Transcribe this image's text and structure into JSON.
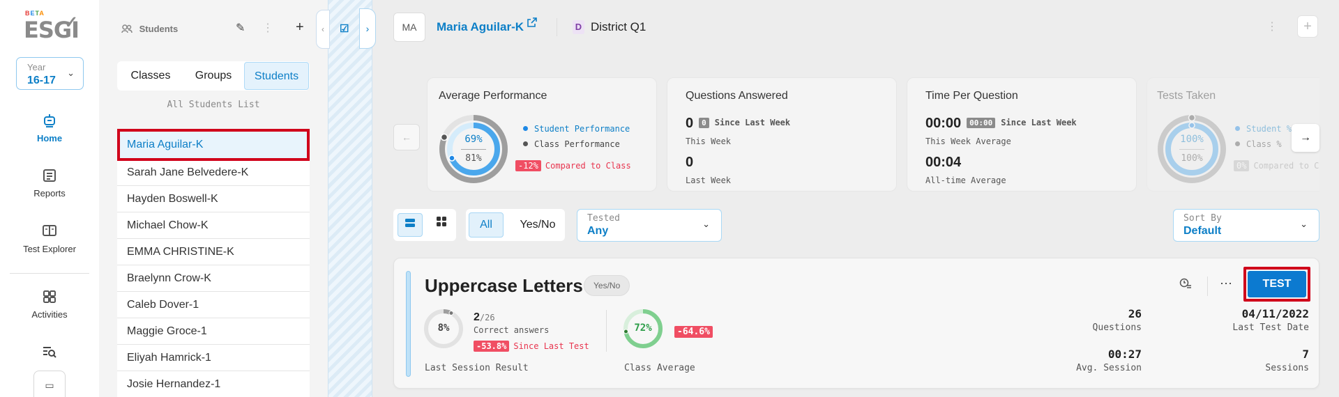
{
  "nav": {
    "logo_beta": "BETA",
    "logo_text": "ESGI",
    "year_label": "Year",
    "year_value": "16-17",
    "items": [
      {
        "label": "Home"
      },
      {
        "label": "Reports"
      },
      {
        "label": "Test Explorer"
      },
      {
        "label": "Activities"
      }
    ]
  },
  "panel": {
    "header": "Students",
    "tabs": [
      "Classes",
      "Groups",
      "Students"
    ],
    "active_tab": "Students",
    "list_title": "All Students List",
    "students": [
      "Maria Aguilar-K",
      "Sarah Jane Belvedere-K",
      "Hayden Boswell-K",
      "Michael Chow-K",
      "EMMA CHRISTINE-K",
      "Braelynn Crow-K",
      "Caleb Dover-1",
      "Maggie Groce-1",
      "Eliyah Hamrick-1",
      "Josie Hernandez-1"
    ],
    "selected_student": "Maria Aguilar-K"
  },
  "topbar": {
    "avatar_initials": "MA",
    "student_name": "Maria Aguilar-K",
    "district_badge": "D",
    "district_name": "District Q1"
  },
  "stats": {
    "avg_perf": {
      "title": "Average Performance",
      "student_pct": "69%",
      "class_pct": "81%",
      "student_value": 69,
      "class_value": 81,
      "legend_student": "Student Performance",
      "legend_class": "Class Performance",
      "delta_badge": "-12%",
      "delta_text": "Compared to Class"
    },
    "questions": {
      "title": "Questions Answered",
      "this_week_value": "0",
      "since_badge": "0",
      "since_text": "Since Last Week",
      "this_week_label": "This Week",
      "last_week_value": "0",
      "last_week_label": "Last Week"
    },
    "time": {
      "title": "Time Per Question",
      "this_week_value": "00:00",
      "since_badge": "00:00",
      "since_text": "Since Last Week",
      "this_week_label": "This Week Average",
      "all_time_value": "00:04",
      "all_time_label": "All-time Average"
    },
    "tests_taken": {
      "title": "Tests Taken",
      "student_pct": "100%",
      "class_pct": "100%",
      "legend_student": "Student %",
      "legend_class": "Class %",
      "delta_badge": "0%",
      "delta_text": "Compared to Class"
    }
  },
  "filters": {
    "type_all": "All",
    "type_yesno": "Yes/No",
    "tested_label": "Tested",
    "tested_value": "Any",
    "sort_label": "Sort By",
    "sort_value": "Default"
  },
  "test_card": {
    "title": "Uppercase Letters",
    "type_badge": "Yes/No",
    "test_button": "TEST",
    "last_session_pct": "8%",
    "last_session_value": 8,
    "correct_num": "2",
    "correct_den": "/26",
    "correct_label": "Correct answers",
    "since_badge": "-53.8%",
    "since_text": "Since Last Test",
    "last_session_label": "Last Session Result",
    "class_avg_pct": "72%",
    "class_avg_value": 72,
    "class_delta_badge": "-64.6%",
    "class_avg_label": "Class Average",
    "questions_value": "26",
    "questions_label": "Questions",
    "last_date_value": "04/11/2022",
    "last_date_label": "Last Test Date",
    "avg_session_value": "00:27",
    "avg_session_label": "Avg. Session",
    "sessions_value": "7",
    "sessions_label": "Sessions"
  },
  "colors": {
    "accent": "#0d7fc7",
    "negative": "#f04e63",
    "selection_outline": "#d0021b",
    "class_green": "#2e9e4a"
  }
}
